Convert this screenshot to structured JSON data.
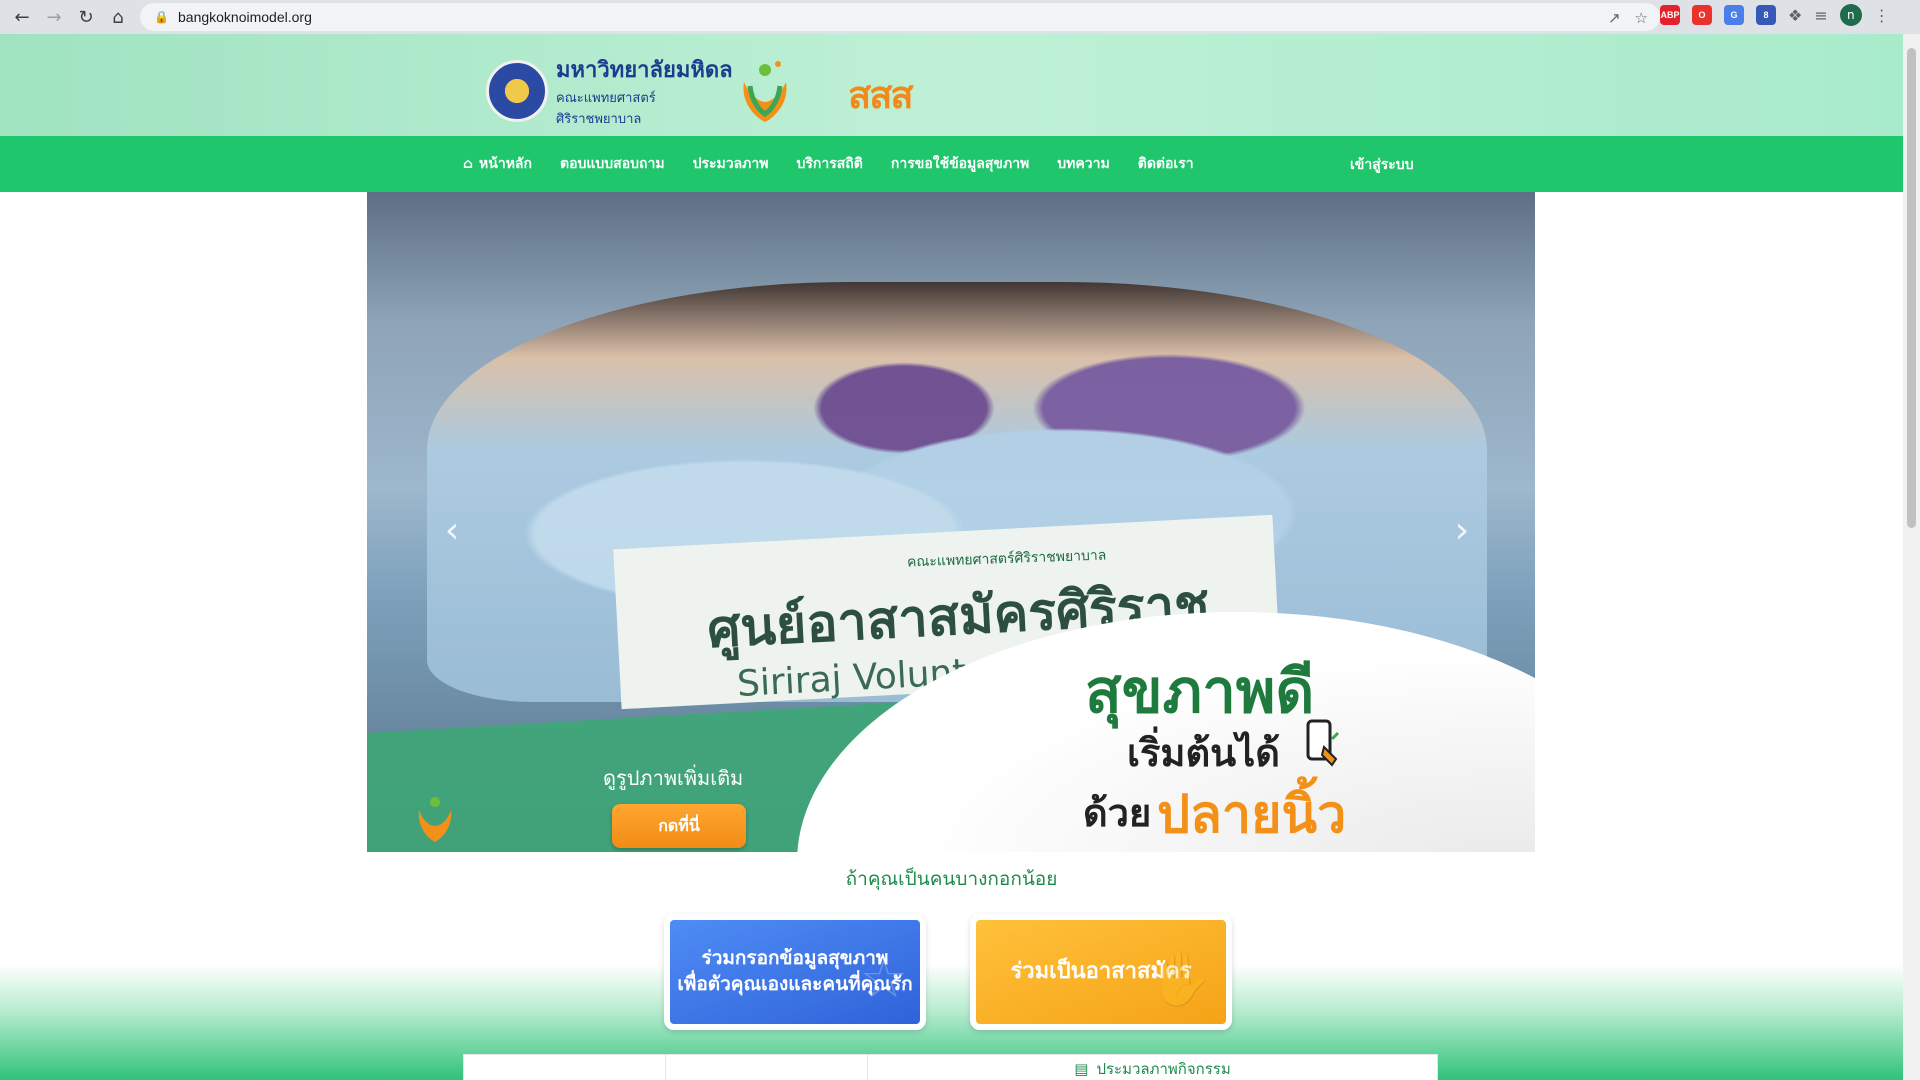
{
  "browser": {
    "url": "bangkoknoimodel.org",
    "profile_initial": "n",
    "extensions": [
      {
        "name": "adblock-plus-icon",
        "label": "ABP",
        "color": "#e4212d"
      },
      {
        "name": "o-extension-icon",
        "label": "O",
        "color": "#e8322b"
      },
      {
        "name": "translate-icon",
        "label": "G",
        "color": "#4a7ee8"
      },
      {
        "name": "shield-extension-icon",
        "label": "8",
        "color": "#3659b8"
      }
    ]
  },
  "header": {
    "university_name": "มหาวิทยาลัยมหิดล",
    "faculty_line1": "คณะแพทยศาสตร์",
    "faculty_line2": "ศิริราชพยาบาล",
    "sss_logo_text": "สสส"
  },
  "navbar": {
    "items": [
      {
        "label": "หน้าหลัก",
        "name": "nav-home"
      },
      {
        "label": "ตอบแบบสอบถาม",
        "name": "nav-survey"
      },
      {
        "label": "ประมวลภาพ",
        "name": "nav-gallery"
      },
      {
        "label": "บริการสถิติ",
        "name": "nav-statistics"
      },
      {
        "label": "การขอใช้ข้อมูลสุขภาพ",
        "name": "nav-data-request"
      },
      {
        "label": "บทความ",
        "name": "nav-articles"
      },
      {
        "label": "ติดต่อเรา",
        "name": "nav-contact"
      }
    ],
    "login_label": "เข้าสู่ระบบ"
  },
  "slider": {
    "banner_top": "คณะแพทยศาสตร์ศิริราชพยาบาล",
    "banner_big": "ศูนย์อาสาสมัครศิริราช",
    "banner_sub": "Siriraj Volunt",
    "slogan_line1": "สุขภาพดี",
    "slogan_line2": "เริ่มต้นได้",
    "slogan_line3a": "ด้วย",
    "slogan_line3b": "ปลายนิ้ว",
    "more_label": "ดูรูปภาพเพิ่มเติม",
    "more_button": "กดที่นี่"
  },
  "tagline": "ถ้าคุณเป็นคนบางกอกน้อย",
  "cta": {
    "blue_line1": "ร่วมกรอกข้อมูลสุขภาพ",
    "blue_line2": "เพื่อตัวคุณเองและคนที่คุณรัก",
    "orange_label": "ร่วมเป็นอาสาสมัคร"
  },
  "bottom_panel": {
    "title": "ประมวลภาพกิจกรรม"
  },
  "colors": {
    "nav_green": "#1fc66b",
    "accent_orange": "#f28c14",
    "cta_blue": "#2f63d9"
  }
}
